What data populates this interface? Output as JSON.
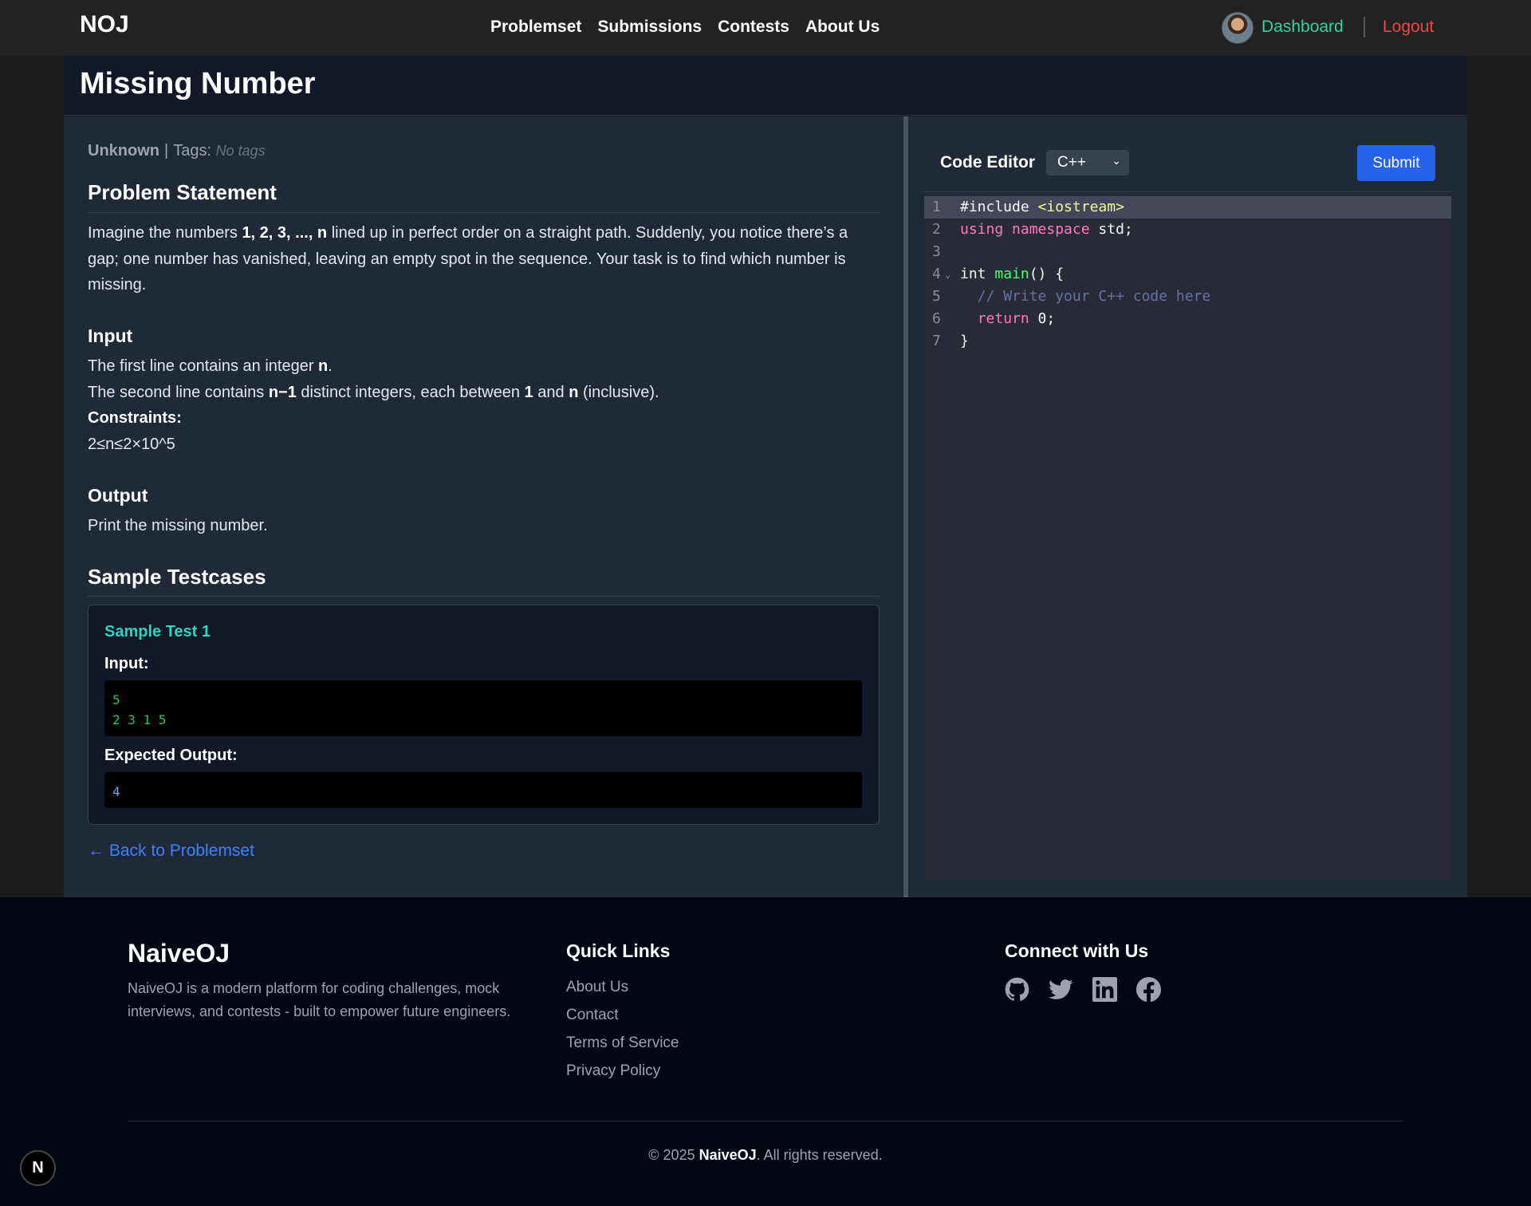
{
  "nav": {
    "brand": "NOJ",
    "links": [
      "Problemset",
      "Submissions",
      "Contests",
      "About Us"
    ],
    "dashboard": "Dashboard",
    "logout": "Logout"
  },
  "problem": {
    "title": "Missing Number",
    "difficulty": "Unknown",
    "tags_label": "Tags:",
    "tags_value": "No tags",
    "statement_heading": "Problem Statement",
    "statement_1": "Imagine the numbers ",
    "statement_bold": "1, 2, 3, ..., n",
    "statement_2": " lined up in perfect order on a straight path. Suddenly, you notice there’s a gap; one number has vanished, leaving an empty spot in the sequence. Your task is to find which number is missing.",
    "input_heading": "Input",
    "input_l1_a": "The first line contains an integer ",
    "input_l1_b": "n",
    "input_l1_c": ".",
    "input_l2_a": "The second line contains ",
    "input_l2_b": "n−1",
    "input_l2_c": " distinct integers, each between ",
    "input_l2_d": "1",
    "input_l2_e": " and ",
    "input_l2_f": "n",
    "input_l2_g": " (inclusive).",
    "constraints_label": "Constraints:",
    "constraints_value": "2≤n≤2×10^5",
    "output_heading": "Output",
    "output_text": "Print the missing number.",
    "samples_heading": "Sample Testcases",
    "sample_title": "Sample Test 1",
    "sample_input_label": "Input:",
    "sample_input_line1": "5",
    "sample_input_line2": "2 3 1 5",
    "sample_output_label": "Expected Output:",
    "sample_output": "4",
    "back_link": "← Back to Problemset"
  },
  "editor": {
    "label": "Code Editor",
    "language": "C++",
    "submit": "Submit",
    "line_numbers": [
      "1",
      "2",
      "3",
      "4",
      "5",
      "6",
      "7"
    ]
  },
  "footer": {
    "brand": "NaiveOJ",
    "description": "NaiveOJ is a modern platform for coding challenges, mock interviews, and contests - built to empower future engineers.",
    "quick_links_heading": "Quick Links",
    "quick_links": [
      "About Us",
      "Contact",
      "Terms of Service",
      "Privacy Policy"
    ],
    "connect_heading": "Connect with Us",
    "social_icons": [
      "github-icon",
      "twitter-icon",
      "linkedin-icon",
      "facebook-icon"
    ],
    "copyright_prefix": "© 2025 ",
    "copyright_brand": "NaiveOJ",
    "copyright_suffix": ". All rights reserved."
  },
  "badge": "N"
}
